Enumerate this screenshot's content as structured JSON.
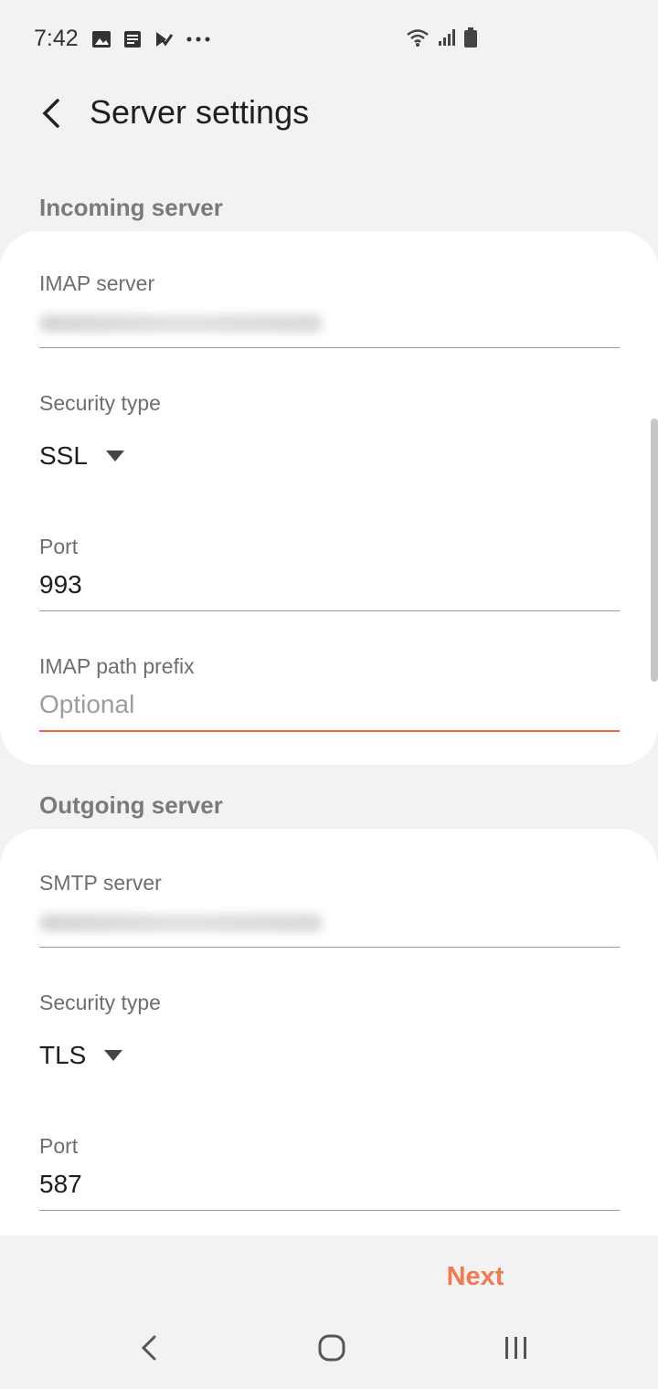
{
  "status_bar": {
    "time": "7:42",
    "left_icons": [
      "image-icon",
      "notes-icon",
      "tasks-icon",
      "more-dots-icon"
    ],
    "right_icons": [
      "wifi-icon",
      "signal-icon",
      "battery-icon"
    ]
  },
  "app_bar": {
    "back_icon": "back-arrow-icon",
    "title": "Server settings"
  },
  "incoming": {
    "header": "Incoming server",
    "server_label": "IMAP server",
    "server_value": "",
    "security_label": "Security type",
    "security_value": "SSL",
    "port_label": "Port",
    "port_value": "993",
    "path_label": "IMAP path prefix",
    "path_placeholder": "Optional"
  },
  "outgoing": {
    "header": "Outgoing server",
    "server_label": "SMTP server",
    "server_value": "",
    "security_label": "Security type",
    "security_value": "TLS",
    "port_label": "Port",
    "port_value": "587"
  },
  "actions": {
    "next_label": "Next"
  },
  "nav": {
    "back": "nav-back-icon",
    "home": "nav-home-icon",
    "recents": "nav-recents-icon"
  },
  "colors": {
    "accent": "#e5693f",
    "next_text": "#f07a52",
    "background": "#f2f2f2",
    "card": "#ffffff"
  }
}
